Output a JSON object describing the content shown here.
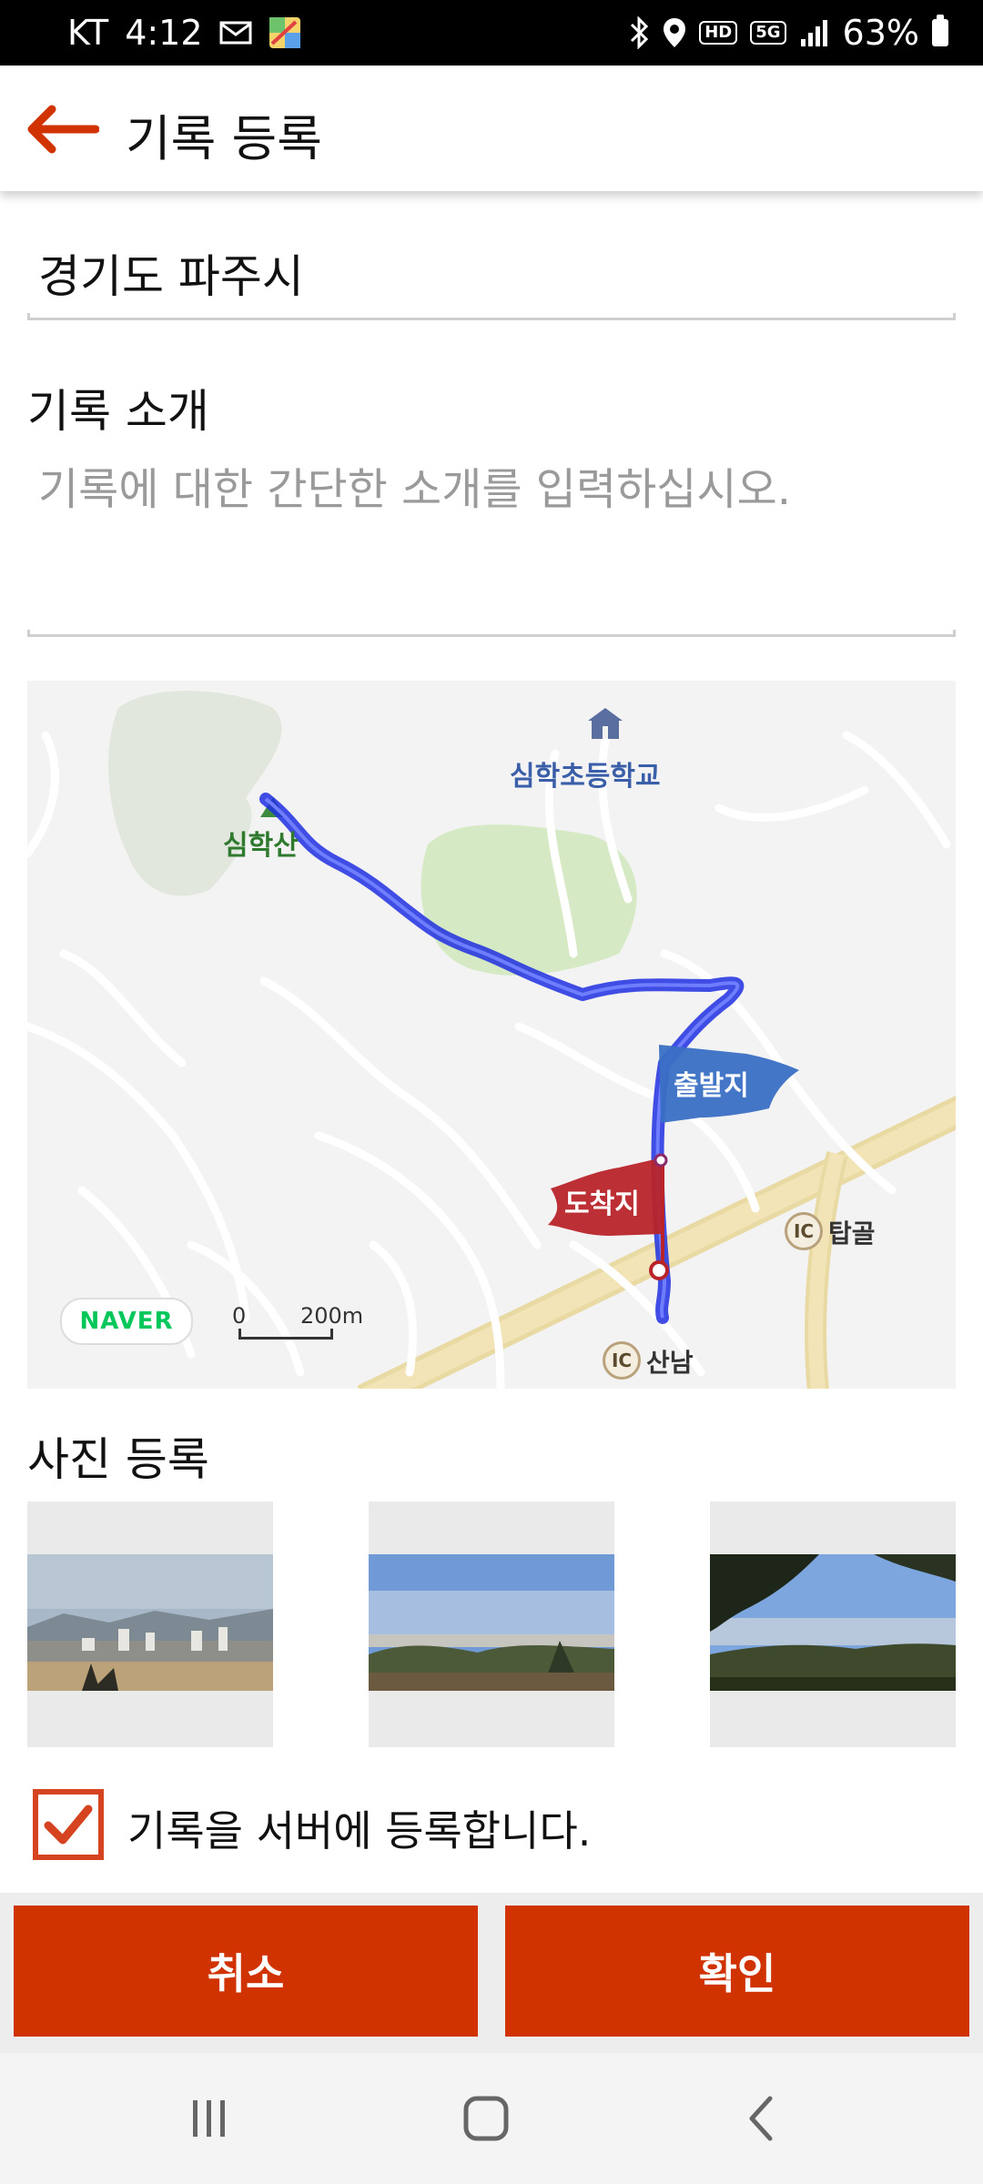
{
  "status_bar": {
    "carrier": "KT",
    "time": "4:12",
    "network_badge_hd": "HD",
    "network_badge_5g": "5G",
    "battery": "63%"
  },
  "app_bar": {
    "title": "기록 등록",
    "back_icon": "arrow-left-icon"
  },
  "form": {
    "location": "경기도 파주시",
    "intro_label": "기록 소개",
    "intro_placeholder": "기록에 대한 간단한 소개를 입력하십시오."
  },
  "map": {
    "school_label": "심학초등학교",
    "mountain_label": "심학산",
    "start_flag": "출발지",
    "end_flag": "도착지",
    "ic1_badge": "IC",
    "ic1_label": "탑골",
    "ic2_badge": "IC",
    "ic2_label": "산남",
    "naver_logo": "NAVER",
    "scale_zero": "0",
    "scale_label": "200m",
    "route_color": "#1f2fe0",
    "start_flag_color": "#3a6fc4",
    "end_flag_color": "#b8242a"
  },
  "photos": {
    "title": "사진 등록",
    "items": [
      "photo-1",
      "photo-2",
      "photo-3"
    ]
  },
  "consent": {
    "checked": true,
    "label": "기록을 서버에 등록합니다."
  },
  "buttons": {
    "cancel": "취소",
    "confirm": "확인",
    "accent": "#d03300"
  },
  "nav": {
    "recents_icon": "recents-icon",
    "home_icon": "home-icon",
    "back_icon": "back-icon"
  }
}
